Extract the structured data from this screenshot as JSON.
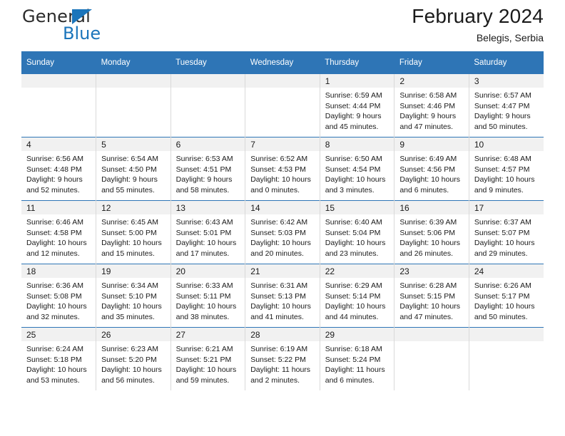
{
  "brand": {
    "name_top": "General",
    "name_bottom": "Blue",
    "accent_color": "#1b75bb",
    "triangle_icon": "triangle-right-icon"
  },
  "header": {
    "title": "February 2024",
    "subtitle": "Belegis, Serbia",
    "header_bg_color": "#2e75b6",
    "daynum_band_color": "#f1f1f1"
  },
  "weekdays": [
    "Sunday",
    "Monday",
    "Tuesday",
    "Wednesday",
    "Thursday",
    "Friday",
    "Saturday"
  ],
  "weeks": [
    [
      {
        "day": "",
        "sunrise": "",
        "sunset": "",
        "daylight1": "",
        "daylight2": ""
      },
      {
        "day": "",
        "sunrise": "",
        "sunset": "",
        "daylight1": "",
        "daylight2": ""
      },
      {
        "day": "",
        "sunrise": "",
        "sunset": "",
        "daylight1": "",
        "daylight2": ""
      },
      {
        "day": "",
        "sunrise": "",
        "sunset": "",
        "daylight1": "",
        "daylight2": ""
      },
      {
        "day": "1",
        "sunrise": "Sunrise: 6:59 AM",
        "sunset": "Sunset: 4:44 PM",
        "daylight1": "Daylight: 9 hours",
        "daylight2": "and 45 minutes."
      },
      {
        "day": "2",
        "sunrise": "Sunrise: 6:58 AM",
        "sunset": "Sunset: 4:46 PM",
        "daylight1": "Daylight: 9 hours",
        "daylight2": "and 47 minutes."
      },
      {
        "day": "3",
        "sunrise": "Sunrise: 6:57 AM",
        "sunset": "Sunset: 4:47 PM",
        "daylight1": "Daylight: 9 hours",
        "daylight2": "and 50 minutes."
      }
    ],
    [
      {
        "day": "4",
        "sunrise": "Sunrise: 6:56 AM",
        "sunset": "Sunset: 4:48 PM",
        "daylight1": "Daylight: 9 hours",
        "daylight2": "and 52 minutes."
      },
      {
        "day": "5",
        "sunrise": "Sunrise: 6:54 AM",
        "sunset": "Sunset: 4:50 PM",
        "daylight1": "Daylight: 9 hours",
        "daylight2": "and 55 minutes."
      },
      {
        "day": "6",
        "sunrise": "Sunrise: 6:53 AM",
        "sunset": "Sunset: 4:51 PM",
        "daylight1": "Daylight: 9 hours",
        "daylight2": "and 58 minutes."
      },
      {
        "day": "7",
        "sunrise": "Sunrise: 6:52 AM",
        "sunset": "Sunset: 4:53 PM",
        "daylight1": "Daylight: 10 hours",
        "daylight2": "and 0 minutes."
      },
      {
        "day": "8",
        "sunrise": "Sunrise: 6:50 AM",
        "sunset": "Sunset: 4:54 PM",
        "daylight1": "Daylight: 10 hours",
        "daylight2": "and 3 minutes."
      },
      {
        "day": "9",
        "sunrise": "Sunrise: 6:49 AM",
        "sunset": "Sunset: 4:56 PM",
        "daylight1": "Daylight: 10 hours",
        "daylight2": "and 6 minutes."
      },
      {
        "day": "10",
        "sunrise": "Sunrise: 6:48 AM",
        "sunset": "Sunset: 4:57 PM",
        "daylight1": "Daylight: 10 hours",
        "daylight2": "and 9 minutes."
      }
    ],
    [
      {
        "day": "11",
        "sunrise": "Sunrise: 6:46 AM",
        "sunset": "Sunset: 4:58 PM",
        "daylight1": "Daylight: 10 hours",
        "daylight2": "and 12 minutes."
      },
      {
        "day": "12",
        "sunrise": "Sunrise: 6:45 AM",
        "sunset": "Sunset: 5:00 PM",
        "daylight1": "Daylight: 10 hours",
        "daylight2": "and 15 minutes."
      },
      {
        "day": "13",
        "sunrise": "Sunrise: 6:43 AM",
        "sunset": "Sunset: 5:01 PM",
        "daylight1": "Daylight: 10 hours",
        "daylight2": "and 17 minutes."
      },
      {
        "day": "14",
        "sunrise": "Sunrise: 6:42 AM",
        "sunset": "Sunset: 5:03 PM",
        "daylight1": "Daylight: 10 hours",
        "daylight2": "and 20 minutes."
      },
      {
        "day": "15",
        "sunrise": "Sunrise: 6:40 AM",
        "sunset": "Sunset: 5:04 PM",
        "daylight1": "Daylight: 10 hours",
        "daylight2": "and 23 minutes."
      },
      {
        "day": "16",
        "sunrise": "Sunrise: 6:39 AM",
        "sunset": "Sunset: 5:06 PM",
        "daylight1": "Daylight: 10 hours",
        "daylight2": "and 26 minutes."
      },
      {
        "day": "17",
        "sunrise": "Sunrise: 6:37 AM",
        "sunset": "Sunset: 5:07 PM",
        "daylight1": "Daylight: 10 hours",
        "daylight2": "and 29 minutes."
      }
    ],
    [
      {
        "day": "18",
        "sunrise": "Sunrise: 6:36 AM",
        "sunset": "Sunset: 5:08 PM",
        "daylight1": "Daylight: 10 hours",
        "daylight2": "and 32 minutes."
      },
      {
        "day": "19",
        "sunrise": "Sunrise: 6:34 AM",
        "sunset": "Sunset: 5:10 PM",
        "daylight1": "Daylight: 10 hours",
        "daylight2": "and 35 minutes."
      },
      {
        "day": "20",
        "sunrise": "Sunrise: 6:33 AM",
        "sunset": "Sunset: 5:11 PM",
        "daylight1": "Daylight: 10 hours",
        "daylight2": "and 38 minutes."
      },
      {
        "day": "21",
        "sunrise": "Sunrise: 6:31 AM",
        "sunset": "Sunset: 5:13 PM",
        "daylight1": "Daylight: 10 hours",
        "daylight2": "and 41 minutes."
      },
      {
        "day": "22",
        "sunrise": "Sunrise: 6:29 AM",
        "sunset": "Sunset: 5:14 PM",
        "daylight1": "Daylight: 10 hours",
        "daylight2": "and 44 minutes."
      },
      {
        "day": "23",
        "sunrise": "Sunrise: 6:28 AM",
        "sunset": "Sunset: 5:15 PM",
        "daylight1": "Daylight: 10 hours",
        "daylight2": "and 47 minutes."
      },
      {
        "day": "24",
        "sunrise": "Sunrise: 6:26 AM",
        "sunset": "Sunset: 5:17 PM",
        "daylight1": "Daylight: 10 hours",
        "daylight2": "and 50 minutes."
      }
    ],
    [
      {
        "day": "25",
        "sunrise": "Sunrise: 6:24 AM",
        "sunset": "Sunset: 5:18 PM",
        "daylight1": "Daylight: 10 hours",
        "daylight2": "and 53 minutes."
      },
      {
        "day": "26",
        "sunrise": "Sunrise: 6:23 AM",
        "sunset": "Sunset: 5:20 PM",
        "daylight1": "Daylight: 10 hours",
        "daylight2": "and 56 minutes."
      },
      {
        "day": "27",
        "sunrise": "Sunrise: 6:21 AM",
        "sunset": "Sunset: 5:21 PM",
        "daylight1": "Daylight: 10 hours",
        "daylight2": "and 59 minutes."
      },
      {
        "day": "28",
        "sunrise": "Sunrise: 6:19 AM",
        "sunset": "Sunset: 5:22 PM",
        "daylight1": "Daylight: 11 hours",
        "daylight2": "and 2 minutes."
      },
      {
        "day": "29",
        "sunrise": "Sunrise: 6:18 AM",
        "sunset": "Sunset: 5:24 PM",
        "daylight1": "Daylight: 11 hours",
        "daylight2": "and 6 minutes."
      },
      {
        "day": "",
        "sunrise": "",
        "sunset": "",
        "daylight1": "",
        "daylight2": ""
      },
      {
        "day": "",
        "sunrise": "",
        "sunset": "",
        "daylight1": "",
        "daylight2": ""
      }
    ]
  ]
}
